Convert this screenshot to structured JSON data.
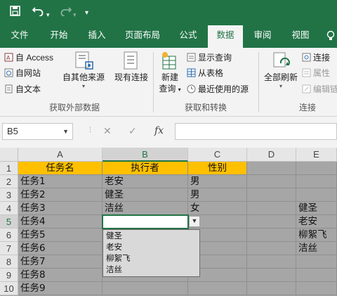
{
  "quick_access": {
    "save_icon": "save-icon",
    "undo_icon": "undo-icon",
    "redo_icon": "redo-icon",
    "customize_icon": "customize-icon"
  },
  "tabs": [
    {
      "label": "文件"
    },
    {
      "label": "开始"
    },
    {
      "label": "插入"
    },
    {
      "label": "页面布局"
    },
    {
      "label": "公式"
    },
    {
      "label": "数据",
      "active": true
    },
    {
      "label": "审阅"
    },
    {
      "label": "视图"
    }
  ],
  "ribbon": {
    "get_external": {
      "access": "自 Access",
      "web": "自网站",
      "text": "自文本",
      "other": "自其他来源",
      "existing": "现有连接",
      "group_label": "获取外部数据"
    },
    "transform": {
      "new_query_1": "新建",
      "new_query_2": "查询",
      "show_queries": "显示查询",
      "from_table": "从表格",
      "recent_sources": "最近使用的源",
      "group_label": "获取和转换"
    },
    "connections": {
      "refresh_all": "全部刷新",
      "connections": "连接",
      "properties": "属性",
      "edit_links": "编辑链",
      "group_label": "连接"
    }
  },
  "formula_bar": {
    "name_box": "B5",
    "cancel": "✕",
    "enter": "✓",
    "fx": "fx",
    "formula": ""
  },
  "columns": [
    "A",
    "B",
    "C",
    "D",
    "E"
  ],
  "rows": [
    "1",
    "2",
    "3",
    "4",
    "5",
    "6",
    "7",
    "8",
    "9",
    "10"
  ],
  "sheet": {
    "header": [
      "任务名",
      "执行者",
      "性别"
    ],
    "data": [
      [
        "任务1",
        "老安",
        "男"
      ],
      [
        "任务2",
        "健圣",
        "男"
      ],
      [
        "任务3",
        "洁丝",
        "女"
      ],
      [
        "任务4",
        "",
        ""
      ],
      [
        "任务5",
        "",
        ""
      ],
      [
        "任务6",
        "",
        ""
      ],
      [
        "任务7",
        "",
        ""
      ],
      [
        "任务8",
        "",
        ""
      ],
      [
        "任务9",
        "",
        ""
      ]
    ],
    "column_e": [
      "健圣",
      "老安",
      "柳絮飞",
      "洁丝"
    ]
  },
  "dropdown_options": [
    "健圣",
    "老安",
    "柳絮飞",
    "洁丝"
  ],
  "colors": {
    "brand": "#217346",
    "header_fill": "#ffc000",
    "cell_fill": "#a6a6a6"
  }
}
